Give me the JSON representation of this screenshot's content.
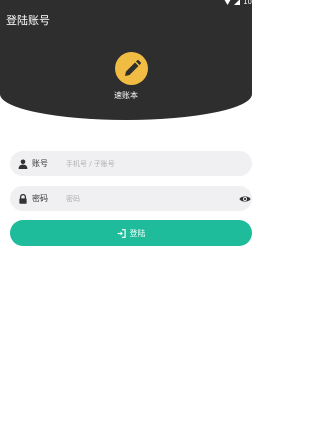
{
  "status_bar": {
    "time": "10"
  },
  "header": {
    "title": "登陆账号",
    "app_name": "速账本"
  },
  "form": {
    "account_label": "账号",
    "account_placeholder": "手机号 / 子账号",
    "password_label": "密码",
    "password_placeholder": "密码",
    "login_label": "登陆"
  },
  "colors": {
    "header_bg": "#2e2e2e",
    "logo_bg": "#f1bc43",
    "accent": "#1ebc9a",
    "field_bg": "#f0f0f2"
  },
  "icons": {
    "account": "user-icon",
    "password": "lock-icon",
    "toggle": "eye-icon",
    "logo": "pencil-icon",
    "login": "login-icon"
  }
}
